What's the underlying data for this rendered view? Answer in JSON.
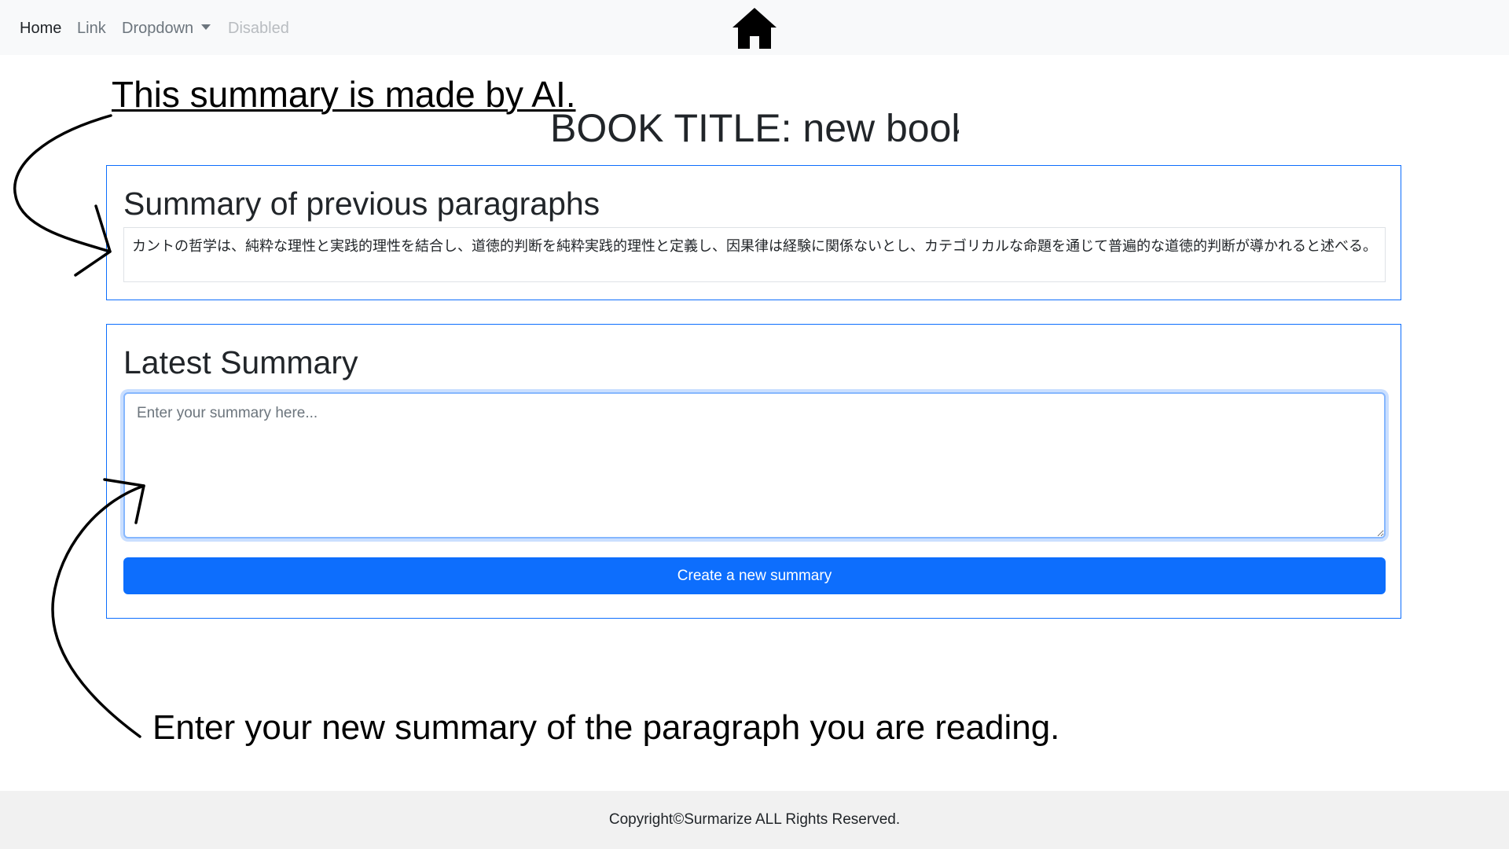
{
  "navbar": {
    "links": [
      {
        "label": "Home"
      },
      {
        "label": "Link"
      },
      {
        "label": "Dropdown"
      },
      {
        "label": "Disabled"
      }
    ],
    "center_icon": "home-icon"
  },
  "annotations": {
    "ai_note": "This summary is made by AI.",
    "enter_note": "Enter your new summary of the paragraph you are reading."
  },
  "book": {
    "title": "BOOK TITLE: new book"
  },
  "previous_summary": {
    "heading": "Summary of previous paragraphs",
    "text": "カントの哲学は、純粋な理性と実践的理性を結合し、道徳的判断を純粋実践的理性と定義し、因果律は経験に関係ないとし、カテゴリカルな命題を通じて普遍的な道徳的判断が導かれると述べる。"
  },
  "latest_summary": {
    "heading": "Latest Summary",
    "input_value": "",
    "input_placeholder": "Enter your summary here...",
    "button_label": "Create a new summary"
  },
  "footer": {
    "text": "Copyright©Surmarize ALL Rights Reserved."
  },
  "colors": {
    "primary": "#0d6efd",
    "navbar_bg": "#f8f9fa",
    "footer_bg": "#f1f1f1",
    "focus_ring": "#86b7fe"
  }
}
